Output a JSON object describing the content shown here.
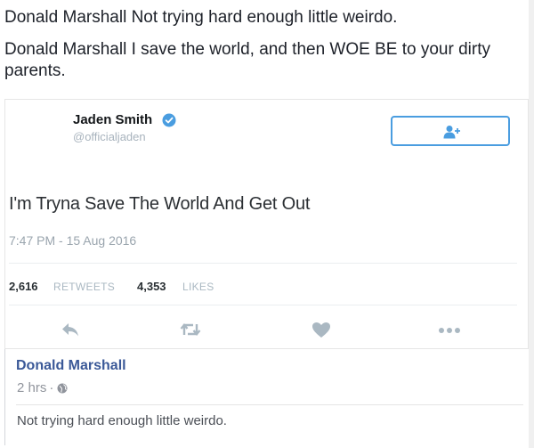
{
  "post": {
    "line1": "Donald Marshall Not trying hard enough little weirdo.",
    "line2": "Donald Marshall I save the world, and then WOE BE to your dirty parents."
  },
  "tweet": {
    "author_name": "Jaden Smith",
    "author_handle": "@officialjaden",
    "text": "I'm Tryna Save The World And Get Out",
    "timestamp": "7:47 PM - 15 Aug 2016",
    "retweets_count": "2,616",
    "retweets_label": "RETWEETS",
    "likes_count": "4,353",
    "likes_label": "LIKES",
    "icons": {
      "verified": "verified-badge-icon",
      "follow": "add-user-icon",
      "reply": "reply-icon",
      "retweet": "retweet-icon",
      "like": "heart-icon",
      "more": "more-icon"
    },
    "colors": {
      "accent": "#4a9de0",
      "icon_gray": "#aab8c2"
    }
  },
  "comment": {
    "author": "Donald Marshall",
    "time": "2 hrs",
    "separator": "·",
    "globe_icon": "globe-icon",
    "text": "Not trying hard enough little weirdo.",
    "author_color": "#3b5998"
  }
}
